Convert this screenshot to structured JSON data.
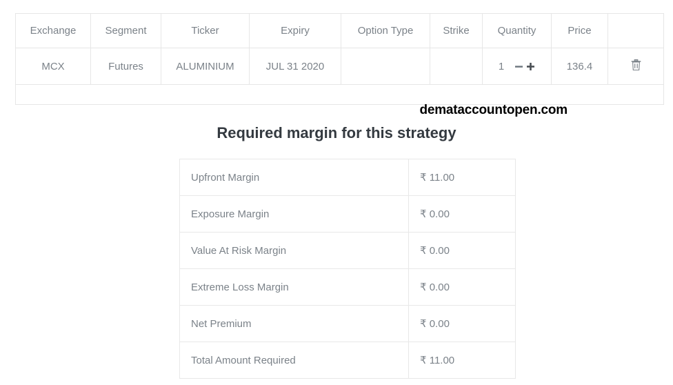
{
  "legs_table": {
    "columns": [
      {
        "key": "exchange",
        "label": "Exchange"
      },
      {
        "key": "segment",
        "label": "Segment"
      },
      {
        "key": "ticker",
        "label": "Ticker"
      },
      {
        "key": "expiry",
        "label": "Expiry"
      },
      {
        "key": "option_type",
        "label": "Option Type"
      },
      {
        "key": "strike",
        "label": "Strike"
      },
      {
        "key": "quantity",
        "label": "Quantity"
      },
      {
        "key": "price",
        "label": "Price"
      },
      {
        "key": "action",
        "label": ""
      }
    ],
    "rows": [
      {
        "exchange": "MCX",
        "segment": "Futures",
        "ticker": "ALUMINIUM",
        "expiry": "JUL 31 2020",
        "option_type": "",
        "strike": "",
        "quantity": "1",
        "price": "136.4",
        "decrease_icon": "minus-icon",
        "increase_icon": "plus-icon",
        "delete_icon": "trash-icon"
      }
    ],
    "has_empty_row": true
  },
  "watermark": {
    "text": "demataccountopen.com"
  },
  "margin_section": {
    "title": "Required margin for this strategy",
    "rows": [
      {
        "label": "Upfront Margin",
        "value": "₹ 11.00"
      },
      {
        "label": "Exposure Margin",
        "value": "₹ 0.00"
      },
      {
        "label": "Value At Risk Margin",
        "value": "₹ 0.00"
      },
      {
        "label": "Extreme Loss Margin",
        "value": "₹ 0.00"
      },
      {
        "label": "Net Premium",
        "value": "₹ 0.00"
      },
      {
        "label": "Total Amount Required",
        "value": "₹ 11.00"
      }
    ]
  },
  "colors": {
    "text_muted": "#7b8289",
    "heading": "#343a40",
    "border": "#e6e6e6",
    "watermark": "#000000"
  }
}
